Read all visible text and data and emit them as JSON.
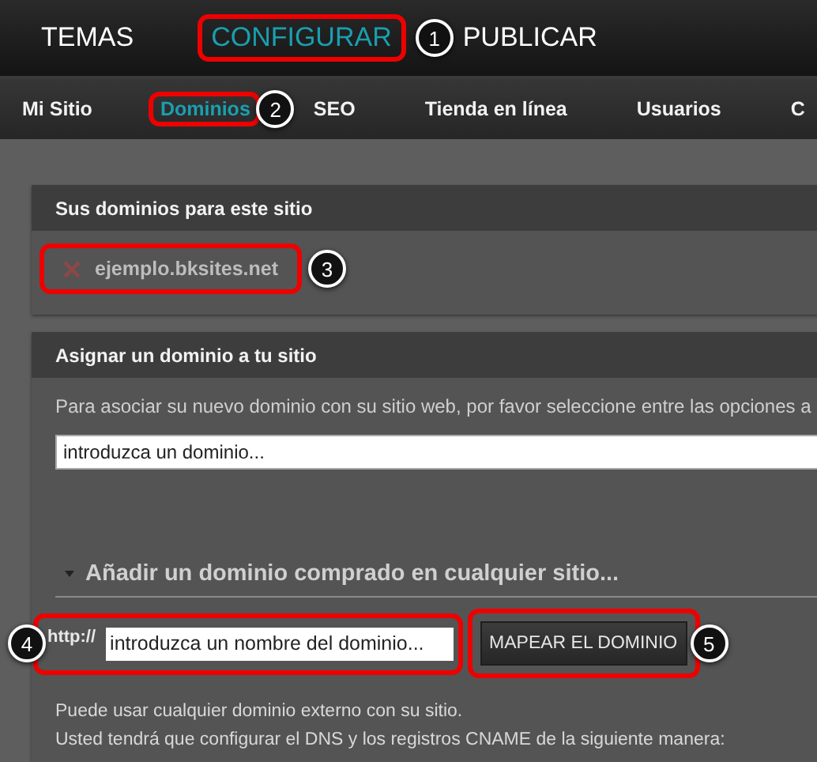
{
  "top_nav": [
    {
      "label": "TEMAS",
      "selected": false
    },
    {
      "label": "CONFIGURAR",
      "selected": true,
      "callout": "1"
    },
    {
      "label": "PUBLICAR",
      "selected": false
    }
  ],
  "sub_nav": [
    {
      "label": "Mi Sitio",
      "selected": false
    },
    {
      "label": "Dominios",
      "selected": true,
      "callout": "2"
    },
    {
      "label": "SEO",
      "selected": false
    },
    {
      "label": "Tienda en línea",
      "selected": false
    },
    {
      "label": "Usuarios",
      "selected": false
    },
    {
      "label": "C",
      "selected": false
    }
  ],
  "domains_panel": {
    "title": "Sus dominios para este sitio",
    "domains": [
      {
        "name": "ejemplo.bksites.net",
        "callout": "3"
      }
    ]
  },
  "assign_panel": {
    "title": "Asignar un dominio a tu sitio",
    "intro": "Para asociar su nuevo dominio con su sitio web, por favor seleccione entre las opciones a",
    "domain_field": {
      "placeholder": "introduzca un dominio..."
    },
    "section": {
      "title": "Añadir un dominio comprado en cualquier sitio...",
      "expanded": true
    },
    "prefix": "http://",
    "name_field": {
      "placeholder": "introduzca un nombre del dominio...",
      "callout": "4"
    },
    "map_button": {
      "label": "MAPEAR EL DOMINIO",
      "callout": "5"
    },
    "notes": [
      "Puede usar cualquier dominio externo con su sitio.",
      "Usted tendrá que configurar el DNS y los registros CNAME de la siguiente manera:"
    ]
  }
}
